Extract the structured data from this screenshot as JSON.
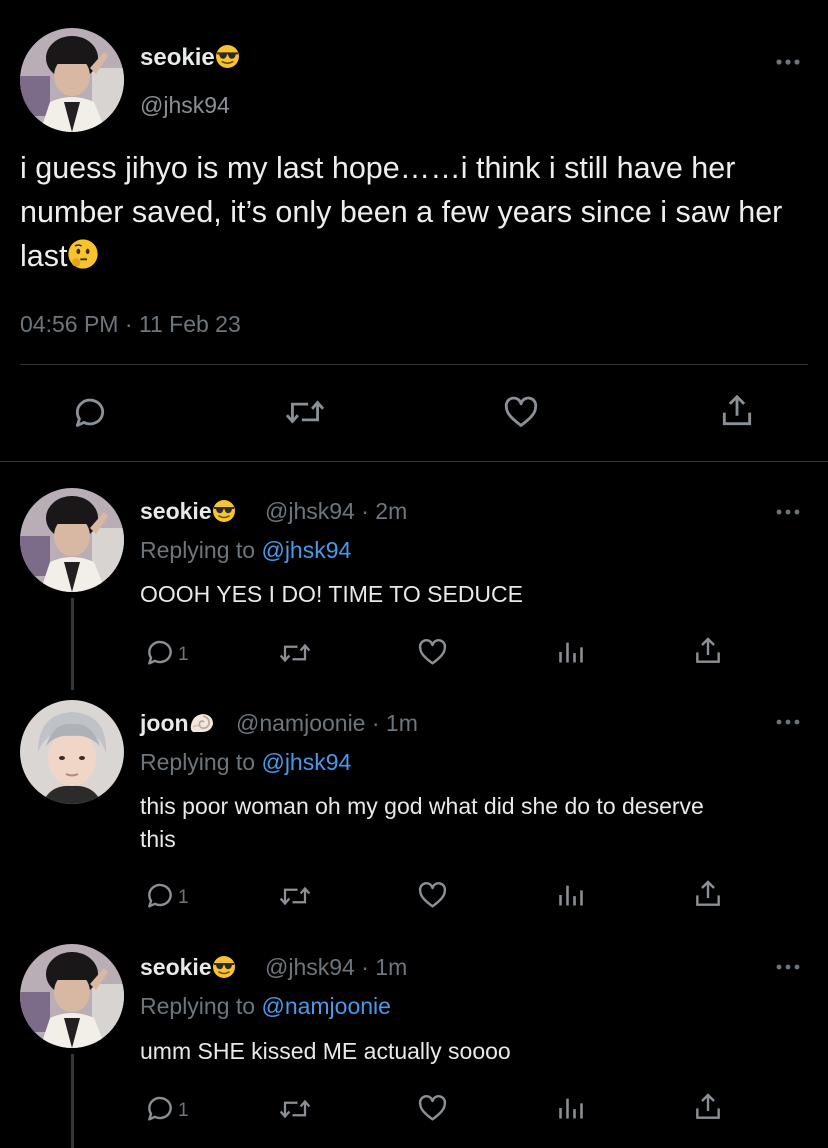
{
  "main_tweet": {
    "display_name": "seokie",
    "name_emoji": "smiling-face-with-sunglasses",
    "handle": "@jhsk94",
    "text": "i guess jihyo is my last hope……i think i still have her number saved, it’s only been a few years since i saw her last",
    "text_emoji": "thinking-face",
    "timestamp": "04:56 PM · 11 Feb 23",
    "actions": [
      "reply-icon",
      "retweet-icon",
      "like-icon",
      "share-icon"
    ]
  },
  "replies": [
    {
      "display_name": "seokie",
      "name_emoji": "smiling-face-with-sunglasses",
      "handle": "@jhsk94",
      "age": "· 2m",
      "replying_label": "Replying to",
      "replying_to": "@jhsk94",
      "text": "OOOH YES I DO! TIME TO SEDUCE",
      "reply_count": "1"
    },
    {
      "display_name": "joon",
      "name_emoji": "spiral-shell",
      "handle": "@namjoonie",
      "age": "· 1m",
      "replying_label": "Replying to",
      "replying_to": "@jhsk94",
      "text": "this poor woman oh my god what did she do to deserve this",
      "reply_count": "1"
    },
    {
      "display_name": "seokie",
      "name_emoji": "smiling-face-with-sunglasses",
      "handle": "@jhsk94",
      "age": "· 1m",
      "replying_label": "Replying to",
      "replying_to": "@namjoonie",
      "text": "umm SHE kissed ME actually soooo",
      "reply_count": "1"
    }
  ],
  "colors": {
    "background": "#000000",
    "text": "#e7e9ea",
    "muted": "#6e767d",
    "mention": "#4a99e9",
    "divider": "#2f3336"
  }
}
